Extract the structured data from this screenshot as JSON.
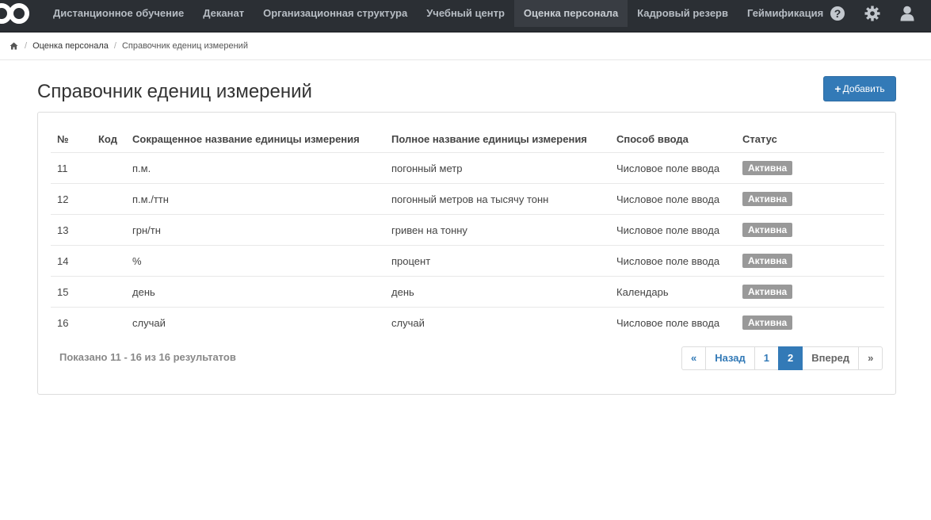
{
  "navbar": {
    "items": [
      {
        "label": "Дистанционное обучение"
      },
      {
        "label": "Деканат"
      },
      {
        "label": "Организационная структура"
      },
      {
        "label": "Учебный центр"
      },
      {
        "label": "Оценка персонала",
        "active": true
      },
      {
        "label": "Кадровый резерв"
      },
      {
        "label": "Геймификация"
      }
    ],
    "icons": [
      "help-icon",
      "gear-icon",
      "user-icon"
    ]
  },
  "breadcrumb": {
    "link": "Оценка персонала",
    "current": "Справочник едениц измерений"
  },
  "page": {
    "title": "Справочник едениц измерений",
    "add_button": "Добавить"
  },
  "table": {
    "headers": [
      "№",
      "Код",
      "Сокращенное название единицы измерения",
      "Полное название единицы измерения",
      "Способ ввода",
      "Статус"
    ],
    "rows": [
      {
        "num": "11",
        "code": "",
        "short": "п.м.",
        "full": "погонный метр",
        "input": "Числовое поле ввода",
        "status": "Активна"
      },
      {
        "num": "12",
        "code": "",
        "short": "п.м./ттн",
        "full": "погонный метров на тысячу тонн",
        "input": "Числовое поле ввода",
        "status": "Активна"
      },
      {
        "num": "13",
        "code": "",
        "short": "грн/тн",
        "full": "гривен на тонну",
        "input": "Числовое поле ввода",
        "status": "Активна"
      },
      {
        "num": "14",
        "code": "",
        "short": "%",
        "full": "процент",
        "input": "Числовое поле ввода",
        "status": "Активна"
      },
      {
        "num": "15",
        "code": "",
        "short": "день",
        "full": "день",
        "input": "Календарь",
        "status": "Активна"
      },
      {
        "num": "16",
        "code": "",
        "short": "случай",
        "full": "случай",
        "input": "Числовое поле ввода",
        "status": "Активна"
      }
    ]
  },
  "summary": "Показано 11 - 16 из 16 результатов",
  "pagination": {
    "first": "«",
    "prev": "Назад",
    "pages": [
      "1",
      "2"
    ],
    "current_page": "2",
    "next": "Вперед",
    "last": "»"
  },
  "colors": {
    "navbar_bg": "#2b2f34",
    "primary": "#337ab7",
    "badge": "#999999"
  }
}
